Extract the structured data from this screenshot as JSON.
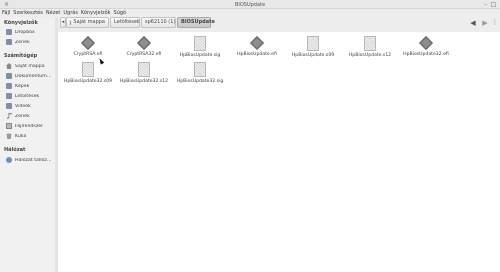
{
  "window": {
    "title": "BIOSUpdate"
  },
  "menubar": {
    "items": [
      "Fájl",
      "Szerkesztés",
      "Nézet",
      "Ugrás",
      "Könyvjelzők",
      "Súgó"
    ]
  },
  "sidebar": {
    "bookmarks_heading": "Könyvjelzők",
    "bookmarks": [
      {
        "label": "Dropbox",
        "icon": "folder-icon"
      },
      {
        "label": "Zenék",
        "icon": "folder-icon"
      }
    ],
    "computer_heading": "Számítógép",
    "computer": [
      {
        "label": "Saját mappa",
        "icon": "home-icon"
      },
      {
        "label": "Dokumentum…",
        "icon": "folder-icon"
      },
      {
        "label": "Képek",
        "icon": "folder-icon"
      },
      {
        "label": "Letöltések",
        "icon": "folder-icon"
      },
      {
        "label": "Videók",
        "icon": "folder-icon"
      },
      {
        "label": "Zenék",
        "icon": "music-icon"
      },
      {
        "label": "Fájlrendszer",
        "icon": "drive-icon"
      },
      {
        "label": "Kuka",
        "icon": "trash-icon"
      }
    ],
    "network_heading": "Hálózat",
    "network": [
      {
        "label": "Hálózat tallóz…",
        "icon": "network-icon"
      }
    ]
  },
  "breadcrumbs": [
    "Saját mappa",
    "Letöltések",
    "sp62110 (1)",
    "BIOSUpdate"
  ],
  "files": [
    {
      "name": "CryptRSA.efi",
      "type": "efi"
    },
    {
      "name": "CryptRSA32.efi",
      "type": "efi"
    },
    {
      "name": "HpBiosUpdate.sig",
      "type": "doc"
    },
    {
      "name": "HpBiosUpdate.efi",
      "type": "efi"
    },
    {
      "name": "HpBiosUpdate.s09",
      "type": "doc"
    },
    {
      "name": "HpBiosUpdate.s12",
      "type": "doc"
    },
    {
      "name": "HpBiosUpdate32.efi",
      "type": "efi"
    },
    {
      "name": "HpBiosUpdate32.s09",
      "type": "doc"
    },
    {
      "name": "HpBiosUpdate32.s12",
      "type": "doc"
    },
    {
      "name": "HpBiosUpdate32.sig",
      "type": "doc"
    }
  ]
}
